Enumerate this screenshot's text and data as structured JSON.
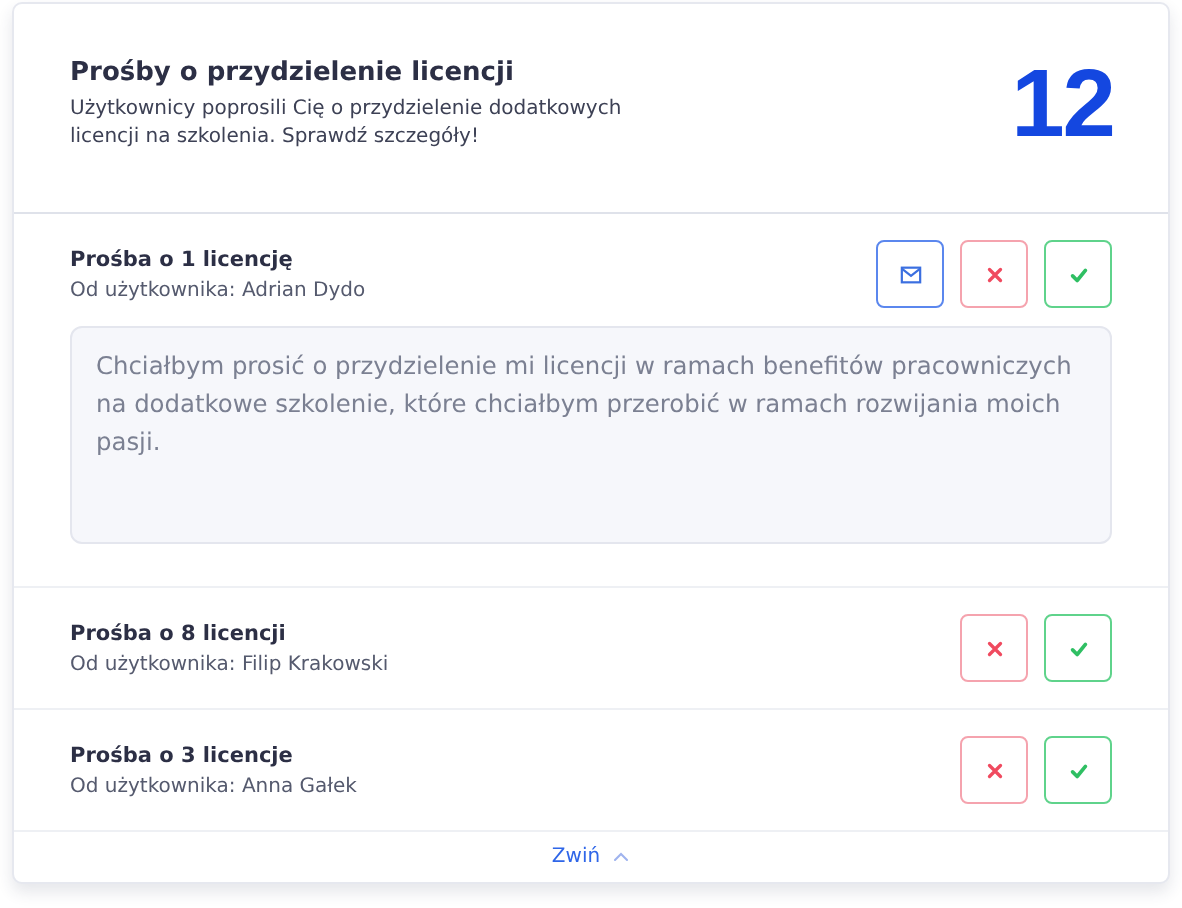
{
  "header": {
    "title": "Prośby o przydzielenie licencji",
    "description": "Użytkownicy poprosili Cię o przydzielenie dodatkowych licencji na szkolenia. Sprawdź szczegóły!",
    "count": "12"
  },
  "requests": [
    {
      "title": "Prośba o 1 licencję",
      "from": "Od użytkownika: Adrian Dydo",
      "expanded": true,
      "message": "Chciałbym prosić o przydzielenie mi licencji w ramach benefitów pracowniczych na dodatkowe szkolenie, które chciałbym przerobić w ramach rozwijania moich pasji."
    },
    {
      "title": "Prośba o 8 licencji",
      "from": "Od użytkownika: Filip Krakowski",
      "expanded": false
    },
    {
      "title": "Prośba o 3 licencje",
      "from": "Od użytkownika: Anna Gałek",
      "expanded": false
    }
  ],
  "footer": {
    "collapse_label": "Zwiń"
  }
}
